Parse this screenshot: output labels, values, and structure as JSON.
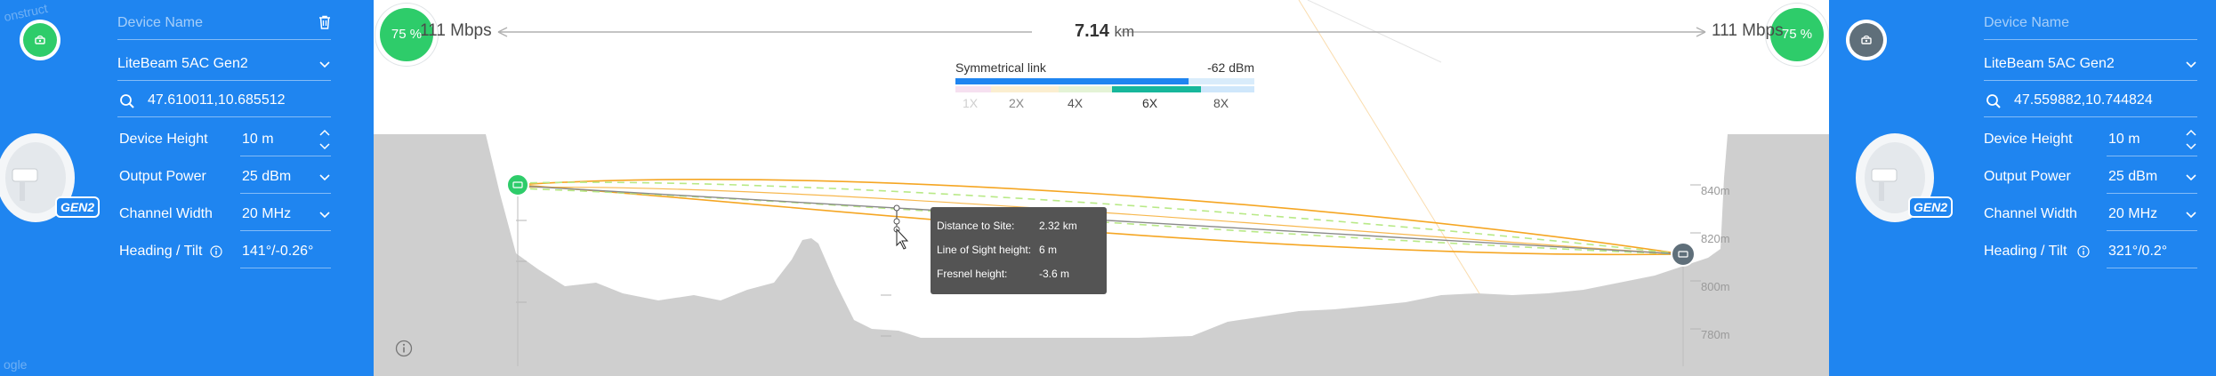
{
  "left_site": {
    "badge_icon": "antenna-icon",
    "badge_color": "#2ecc6a",
    "device_name_placeholder": "Device Name",
    "delete_icon": "trash-icon",
    "model": "LiteBeam 5AC Gen2",
    "coordinates": "47.610011,10.685512",
    "device_height_label": "Device Height",
    "device_height_value": "10 m",
    "output_power_label": "Output Power",
    "output_power_value": "25 dBm",
    "channel_width_label": "Channel Width",
    "channel_width_value": "20 MHz",
    "heading_label": "Heading / Tilt",
    "heading_value": "141°/-0.26°",
    "image_badge": "GEN2",
    "watermark": "onstruct",
    "watermark2": "ogle"
  },
  "right_site": {
    "badge_icon": "antenna-icon",
    "badge_color": "#5f6f7a",
    "device_name_placeholder": "Device Name",
    "model": "LiteBeam 5AC Gen2",
    "coordinates": "47.559882,10.744824",
    "device_height_label": "Device Height",
    "device_height_value": "10 m",
    "output_power_label": "Output Power",
    "output_power_value": "25 dBm",
    "channel_width_label": "Channel Width",
    "channel_width_value": "20 MHz",
    "heading_label": "Heading / Tilt",
    "heading_value": "321°/0.2°",
    "image_badge": "GEN2"
  },
  "link": {
    "left_percent": "75 %",
    "right_percent": "75 %",
    "left_rate": "111 Mbps",
    "right_rate": "111 Mbps",
    "distance_value": "7.14",
    "distance_unit": "km",
    "link_type": "Symmetrical link",
    "signal": "-62 dBm",
    "modulations": [
      "1X",
      "2X",
      "4X",
      "6X",
      "8X"
    ],
    "active_modulation": "6X",
    "signal_fill_fraction": 0.78
  },
  "profile": {
    "elevation_ticks": [
      "840m",
      "820m",
      "800m",
      "780m"
    ],
    "tooltip": {
      "distance_label": "Distance to Site:",
      "distance_value": "2.32 km",
      "los_label": "Line of Sight height:",
      "los_value": "6 m",
      "fresnel_label": "Fresnel height:",
      "fresnel_value": "-3.6 m"
    },
    "colors": {
      "terrain": "#cfcfcf",
      "fresnel_zone": "#f5a623",
      "los_line": "#8a8a8a",
      "clearance_line": "#b8e986"
    }
  },
  "colors": {
    "panel_blue": "#1f85f0",
    "success_green": "#2ecc6a",
    "signal_blue": "#1f85f0",
    "signal_teal": "#17b79b"
  }
}
